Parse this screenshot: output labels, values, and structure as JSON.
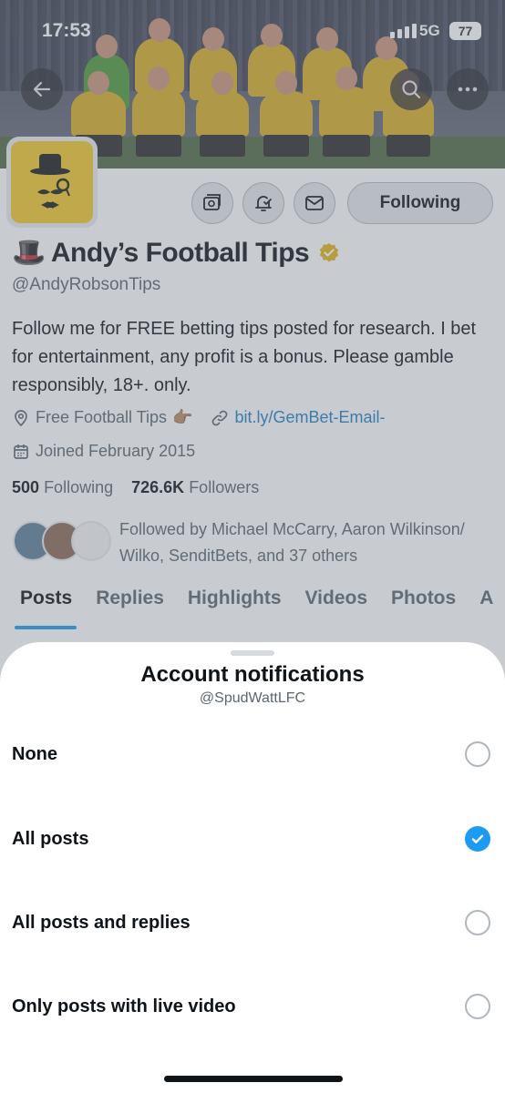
{
  "status_bar": {
    "time": "17:53",
    "network": "5G",
    "battery": "77"
  },
  "profile": {
    "name": "Andy’s Football Tips",
    "name_emoji": "🎩",
    "handle": "@AndyRobsonTips",
    "bio": "Follow me for FREE betting tips posted for research. I bet for entertainment, any profit is a bonus. Please gamble responsibly, 18+. only.",
    "category": "Free Football Tips",
    "category_emoji": "👉🏽",
    "link": "bit.ly/GemBet-Email-",
    "joined": "Joined February 2015",
    "following_count": "500",
    "following_label": "Following",
    "followers_count": "726.6K",
    "followers_label": "Followers",
    "followed_by": "Followed by Michael McCarry, Aaron Wilkinson/ Wilko, SenditBets, and 37 others",
    "follow_button": "Following",
    "tabs": [
      "Posts",
      "Replies",
      "Highlights",
      "Videos",
      "Photos",
      "A"
    ],
    "active_tab": "Posts"
  },
  "sheet": {
    "title": "Account notifications",
    "subtitle": "@SpudWattLFC",
    "options": [
      {
        "label": "None",
        "selected": false
      },
      {
        "label": "All posts",
        "selected": true
      },
      {
        "label": "All posts and replies",
        "selected": false
      },
      {
        "label": "Only posts with live video",
        "selected": false
      }
    ]
  },
  "colors": {
    "accent": "#1d9bf0",
    "link": "#1d7ec3",
    "avatar_bg": "#f3c82b",
    "verified": "#e2b719"
  },
  "icons": [
    "back-arrow-icon",
    "search-icon",
    "more-icon",
    "subscribe-icon",
    "notification-bell-icon",
    "mail-icon",
    "location-icon",
    "link-icon",
    "calendar-icon",
    "checkmark-icon",
    "verified-badge-icon"
  ]
}
